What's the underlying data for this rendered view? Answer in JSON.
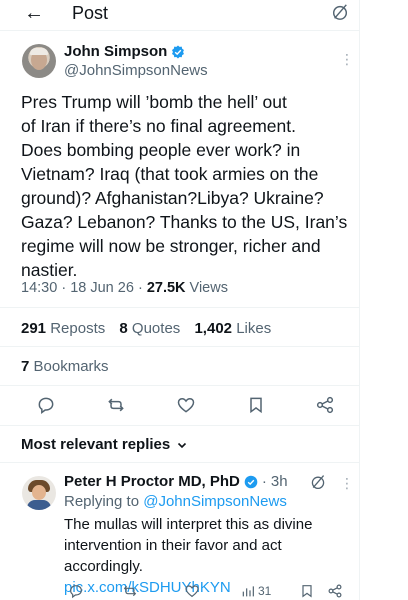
{
  "header": {
    "back_icon": "arrow-left-icon",
    "title": "Post",
    "grok_icon": "grok-icon"
  },
  "tweet": {
    "author_name": "John Simpson",
    "author_handle": "@JohnSimpsonNews",
    "verified_color": "#1d9bf0",
    "more_label": "⋮",
    "text_lines": [
      "Pres Trump will ’bomb the hell’ out",
      "of Iran if there’s no final agreement.",
      "Does bombing people ever work?  in",
      "Vietnam?  Iraq (that took armies on the",
      "ground)? Afghanistan?Libya? Ukraine?",
      "Gaza? Lebanon? Thanks to the US, Iran’s",
      "regime will now be stronger, richer and",
      "nastier."
    ],
    "time": "14:30",
    "sep1": "·",
    "date": "18 Jun 26",
    "sep2": "·",
    "views_count": "27.5K",
    "views_label": "Views"
  },
  "stats": {
    "reposts_count": "291",
    "reposts_label": "Reposts",
    "quotes_count": "8",
    "quotes_label": "Quotes",
    "likes_count": "1,402",
    "likes_label": "Likes",
    "bookmarks_count": "7",
    "bookmarks_label": "Bookmarks"
  },
  "actions": [
    "reply-icon",
    "repost-icon",
    "like-icon",
    "bookmark-icon",
    "share-icon"
  ],
  "replies_filter": {
    "label": "Most relevant replies",
    "icon": "chevron-down-icon"
  },
  "reply": {
    "author_name": "Peter H Proctor MD, PhD",
    "sep": "·",
    "time": "3h",
    "replying_prefix": "Replying to",
    "replying_handle": "@JohnSimpsonNews",
    "text_lines": [
      "The mullas will interpret this as divine",
      "intervention in their favor and act",
      "accordingly."
    ],
    "link": "pic.x.com/kSDHUYhKYN",
    "views_count": "31"
  },
  "colors": {
    "accent": "#1d9bf0",
    "secondary_text": "#536471",
    "divider": "#eff3f4"
  }
}
